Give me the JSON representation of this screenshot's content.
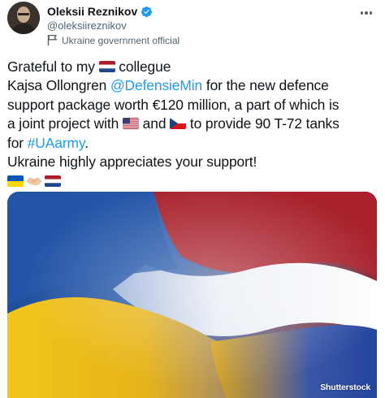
{
  "author": {
    "name": "Oleksii Reznikov",
    "handle": "@oleksiireznikov",
    "affiliation": "Ukraine government official"
  },
  "tweet": {
    "line1_pre": "Grateful to my ",
    "line1_post": " collegue",
    "line2_pre": "Kajsa Ollongren ",
    "line2_mention": "@DefensieMin",
    "line2_post": " for the new defence",
    "line3": "support package worth €120 million, a part of which is",
    "line4_pre": "a joint project with ",
    "line4_mid": " and ",
    "line4_post": " to provide 90 T-72 tanks",
    "line5_pre": "for ",
    "line5_hashtag": "#UAarmy",
    "line5_post": ".",
    "line6": "Ukraine highly appreciates your support!"
  },
  "media": {
    "watermark": "Shutterstock"
  },
  "icons": {
    "verified": "verified-badge-icon",
    "government": "government-flag-icon",
    "more": "more-options-icon"
  },
  "colors": {
    "link": "#1d9bf0",
    "text": "#0f1419",
    "secondary": "#536471",
    "verified": "#1d9bf0"
  }
}
